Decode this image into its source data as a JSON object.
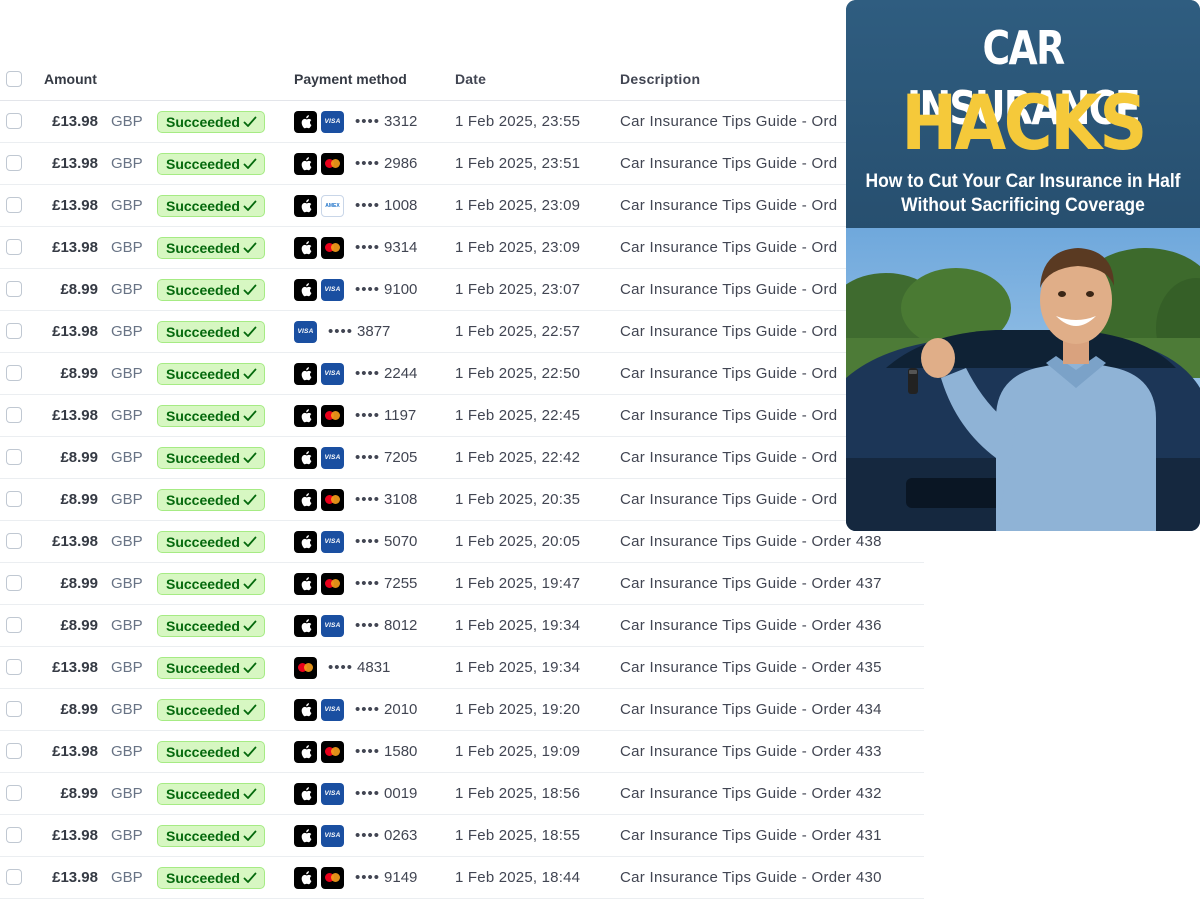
{
  "table": {
    "columns": {
      "amount": "Amount",
      "payment_method": "Payment method",
      "date": "Date",
      "description": "Description"
    },
    "rows": [
      {
        "amount": "£13.98",
        "currency": "GBP",
        "status": "Succeeded",
        "methods": [
          "apple",
          "visa"
        ],
        "last4": "3312",
        "date": "1 Feb 2025, 23:55",
        "description": "Car Insurance Tips Guide - Ord"
      },
      {
        "amount": "£13.98",
        "currency": "GBP",
        "status": "Succeeded",
        "methods": [
          "apple",
          "mastercard"
        ],
        "last4": "2986",
        "date": "1 Feb 2025, 23:51",
        "description": "Car Insurance Tips Guide - Ord"
      },
      {
        "amount": "£13.98",
        "currency": "GBP",
        "status": "Succeeded",
        "methods": [
          "apple",
          "amex"
        ],
        "last4": "1008",
        "date": "1 Feb 2025, 23:09",
        "description": "Car Insurance Tips Guide - Ord"
      },
      {
        "amount": "£13.98",
        "currency": "GBP",
        "status": "Succeeded",
        "methods": [
          "apple",
          "mastercard"
        ],
        "last4": "9314",
        "date": "1 Feb 2025, 23:09",
        "description": "Car Insurance Tips Guide - Ord"
      },
      {
        "amount": "£8.99",
        "currency": "GBP",
        "status": "Succeeded",
        "methods": [
          "apple",
          "visa"
        ],
        "last4": "9100",
        "date": "1 Feb 2025, 23:07",
        "description": "Car Insurance Tips Guide - Ord"
      },
      {
        "amount": "£13.98",
        "currency": "GBP",
        "status": "Succeeded",
        "methods": [
          "visa"
        ],
        "last4": "3877",
        "date": "1 Feb 2025, 22:57",
        "description": "Car Insurance Tips Guide - Ord"
      },
      {
        "amount": "£8.99",
        "currency": "GBP",
        "status": "Succeeded",
        "methods": [
          "apple",
          "visa"
        ],
        "last4": "2244",
        "date": "1 Feb 2025, 22:50",
        "description": "Car Insurance Tips Guide - Ord"
      },
      {
        "amount": "£13.98",
        "currency": "GBP",
        "status": "Succeeded",
        "methods": [
          "apple",
          "mastercard"
        ],
        "last4": "1197",
        "date": "1 Feb 2025, 22:45",
        "description": "Car Insurance Tips Guide - Ord"
      },
      {
        "amount": "£8.99",
        "currency": "GBP",
        "status": "Succeeded",
        "methods": [
          "apple",
          "visa"
        ],
        "last4": "7205",
        "date": "1 Feb 2025, 22:42",
        "description": "Car Insurance Tips Guide - Ord"
      },
      {
        "amount": "£8.99",
        "currency": "GBP",
        "status": "Succeeded",
        "methods": [
          "apple",
          "mastercard"
        ],
        "last4": "3108",
        "date": "1 Feb 2025, 20:35",
        "description": "Car Insurance Tips Guide - Ord"
      },
      {
        "amount": "£13.98",
        "currency": "GBP",
        "status": "Succeeded",
        "methods": [
          "apple",
          "visa"
        ],
        "last4": "5070",
        "date": "1 Feb 2025, 20:05",
        "description": "Car Insurance Tips Guide - Order 438"
      },
      {
        "amount": "£8.99",
        "currency": "GBP",
        "status": "Succeeded",
        "methods": [
          "apple",
          "mastercard"
        ],
        "last4": "7255",
        "date": "1 Feb 2025, 19:47",
        "description": "Car Insurance Tips Guide - Order 437"
      },
      {
        "amount": "£8.99",
        "currency": "GBP",
        "status": "Succeeded",
        "methods": [
          "apple",
          "visa"
        ],
        "last4": "8012",
        "date": "1 Feb 2025, 19:34",
        "description": "Car Insurance Tips Guide - Order 436"
      },
      {
        "amount": "£13.98",
        "currency": "GBP",
        "status": "Succeeded",
        "methods": [
          "mastercard"
        ],
        "last4": "4831",
        "date": "1 Feb 2025, 19:34",
        "description": "Car Insurance Tips Guide - Order 435"
      },
      {
        "amount": "£8.99",
        "currency": "GBP",
        "status": "Succeeded",
        "methods": [
          "apple",
          "visa"
        ],
        "last4": "2010",
        "date": "1 Feb 2025, 19:20",
        "description": "Car Insurance Tips Guide - Order 434"
      },
      {
        "amount": "£13.98",
        "currency": "GBP",
        "status": "Succeeded",
        "methods": [
          "apple",
          "mastercard"
        ],
        "last4": "1580",
        "date": "1 Feb 2025, 19:09",
        "description": "Car Insurance Tips Guide - Order 433"
      },
      {
        "amount": "£8.99",
        "currency": "GBP",
        "status": "Succeeded",
        "methods": [
          "apple",
          "visa"
        ],
        "last4": "0019",
        "date": "1 Feb 2025, 18:56",
        "description": "Car Insurance Tips Guide - Order 432"
      },
      {
        "amount": "£13.98",
        "currency": "GBP",
        "status": "Succeeded",
        "methods": [
          "apple",
          "visa"
        ],
        "last4": "0263",
        "date": "1 Feb 2025, 18:55",
        "description": "Car Insurance Tips Guide - Order 431"
      },
      {
        "amount": "£13.98",
        "currency": "GBP",
        "status": "Succeeded",
        "methods": [
          "apple",
          "mastercard"
        ],
        "last4": "9149",
        "date": "1 Feb 2025, 18:44",
        "description": "Car Insurance Tips Guide - Order 430"
      }
    ],
    "masked_prefix": "•••• "
  },
  "promo": {
    "title_line1": "CAR INSURANCE",
    "title_line2": "HACKS",
    "subtitle_line1": "How to Cut Your Car Insurance in Half",
    "subtitle_line2": "Without Sacrificing Coverage"
  },
  "colors": {
    "badge_bg": "#d7f7c2",
    "badge_text": "#05690d",
    "promo_bg": "#2f5d80",
    "promo_accent": "#f5c93a"
  }
}
